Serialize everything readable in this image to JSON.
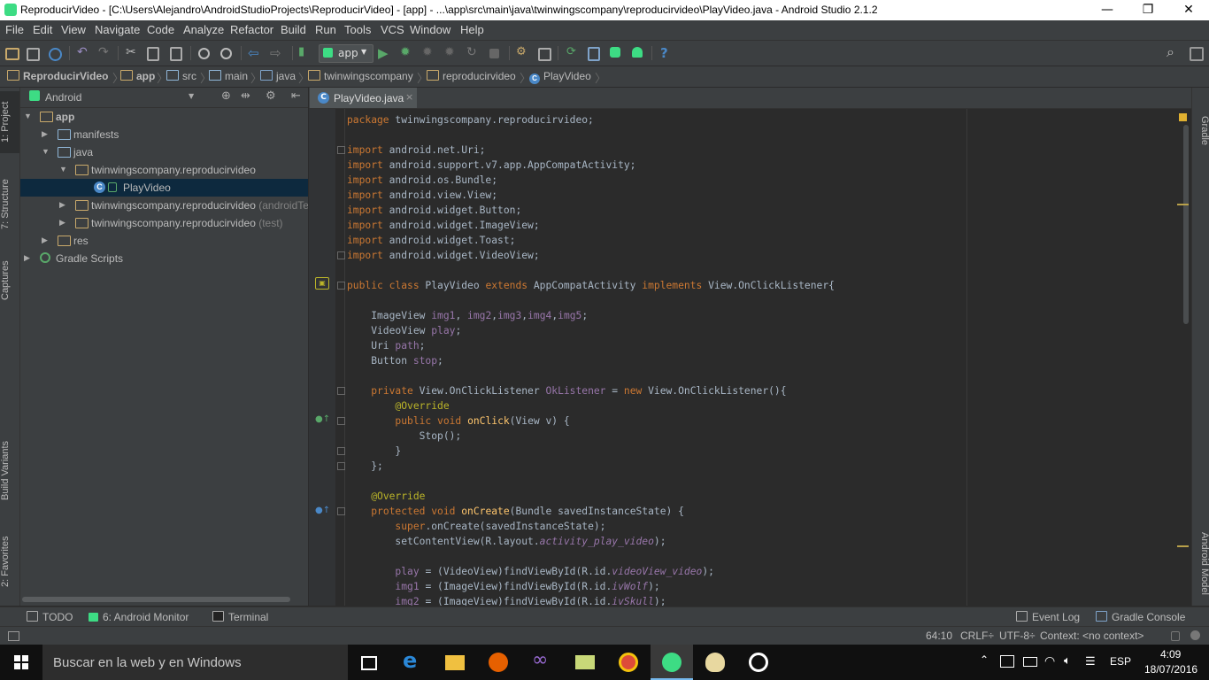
{
  "window": {
    "title": "ReproducirVideo - [C:\\Users\\Alejandro\\AndroidStudioProjects\\ReproducirVideo] - [app] - ...\\app\\src\\main\\java\\twinwingscompany\\reproducirvideo\\PlayVideo.java - Android Studio 2.1.2",
    "minimize": "—",
    "restore": "❐",
    "close": "✕"
  },
  "menu": [
    "File",
    "Edit",
    "View",
    "Navigate",
    "Code",
    "Analyze",
    "Refactor",
    "Build",
    "Run",
    "Tools",
    "VCS",
    "Window",
    "Help"
  ],
  "toolbar": {
    "run_config": "app",
    "help_glyph": "?",
    "search_glyph": "⌕"
  },
  "breadcrumb": [
    "ReproducirVideo",
    "app",
    "src",
    "main",
    "java",
    "twinwingscompany",
    "reproducirvideo",
    "PlayVideo"
  ],
  "left_stripe": [
    "1: Project",
    "7: Structure",
    "Captures",
    "Build Variants",
    "2: Favorites"
  ],
  "right_stripe": [
    "Gradle",
    "Android Model"
  ],
  "project_panel": {
    "view_mode": "Android",
    "tree": [
      {
        "label": "app",
        "suffix": ""
      },
      {
        "label": "manifests",
        "suffix": ""
      },
      {
        "label": "java",
        "suffix": ""
      },
      {
        "label": "twinwingscompany.reproducirvideo",
        "suffix": ""
      },
      {
        "label": "PlayVideo",
        "suffix": ""
      },
      {
        "label": "twinwingscompany.reproducirvideo",
        "suffix": "(androidTest)"
      },
      {
        "label": "twinwingscompany.reproducirvideo",
        "suffix": "(test)"
      },
      {
        "label": "res",
        "suffix": ""
      },
      {
        "label": "Gradle Scripts",
        "suffix": ""
      }
    ]
  },
  "editor": {
    "tab_label": "PlayVideo.java",
    "tab_close": "×"
  },
  "bottom_tabs": {
    "todo": "TODO",
    "android_monitor": "6: Android Monitor",
    "terminal": "Terminal",
    "event_log": "Event Log",
    "gradle_console": "Gradle Console"
  },
  "status": {
    "position": "64:10",
    "line_sep": "CRLF÷",
    "encoding": "UTF-8÷",
    "context": "Context: <no context>"
  },
  "taskbar": {
    "search_placeholder": "Buscar en la web y en Windows",
    "language": "ESP",
    "time": "4:09",
    "date": "18/07/2016"
  },
  "colors": {
    "keyword": "#cc7832",
    "annotation": "#bbb529",
    "field": "#9876aa",
    "method": "#ffc66d",
    "text": "#a9b7c6",
    "selection": "#0d293e"
  }
}
